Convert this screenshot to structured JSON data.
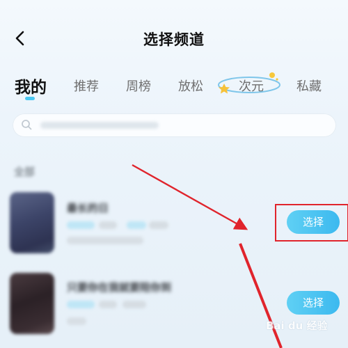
{
  "header": {
    "title": "选择频道"
  },
  "tabs": [
    {
      "label": "我的",
      "active": true
    },
    {
      "label": "推荐",
      "active": false
    },
    {
      "label": "周榜",
      "active": false
    },
    {
      "label": "放松",
      "active": false
    },
    {
      "label": "次元",
      "active": false
    },
    {
      "label": "私藏",
      "active": false
    }
  ],
  "search": {
    "placeholder": "",
    "icon": "search-icon"
  },
  "section": {
    "title": "全部"
  },
  "channels": [
    {
      "name": "最长的日",
      "action_label": "选择",
      "highlighted": true
    },
    {
      "name": "只要你在我就要陪你到",
      "action_label": "选择",
      "highlighted": false
    }
  ],
  "watermark": {
    "text": "Bai du 经验"
  },
  "colors": {
    "accent": "#3cb9ef",
    "annotation": "#e0242c",
    "background": "#eef5fb"
  }
}
